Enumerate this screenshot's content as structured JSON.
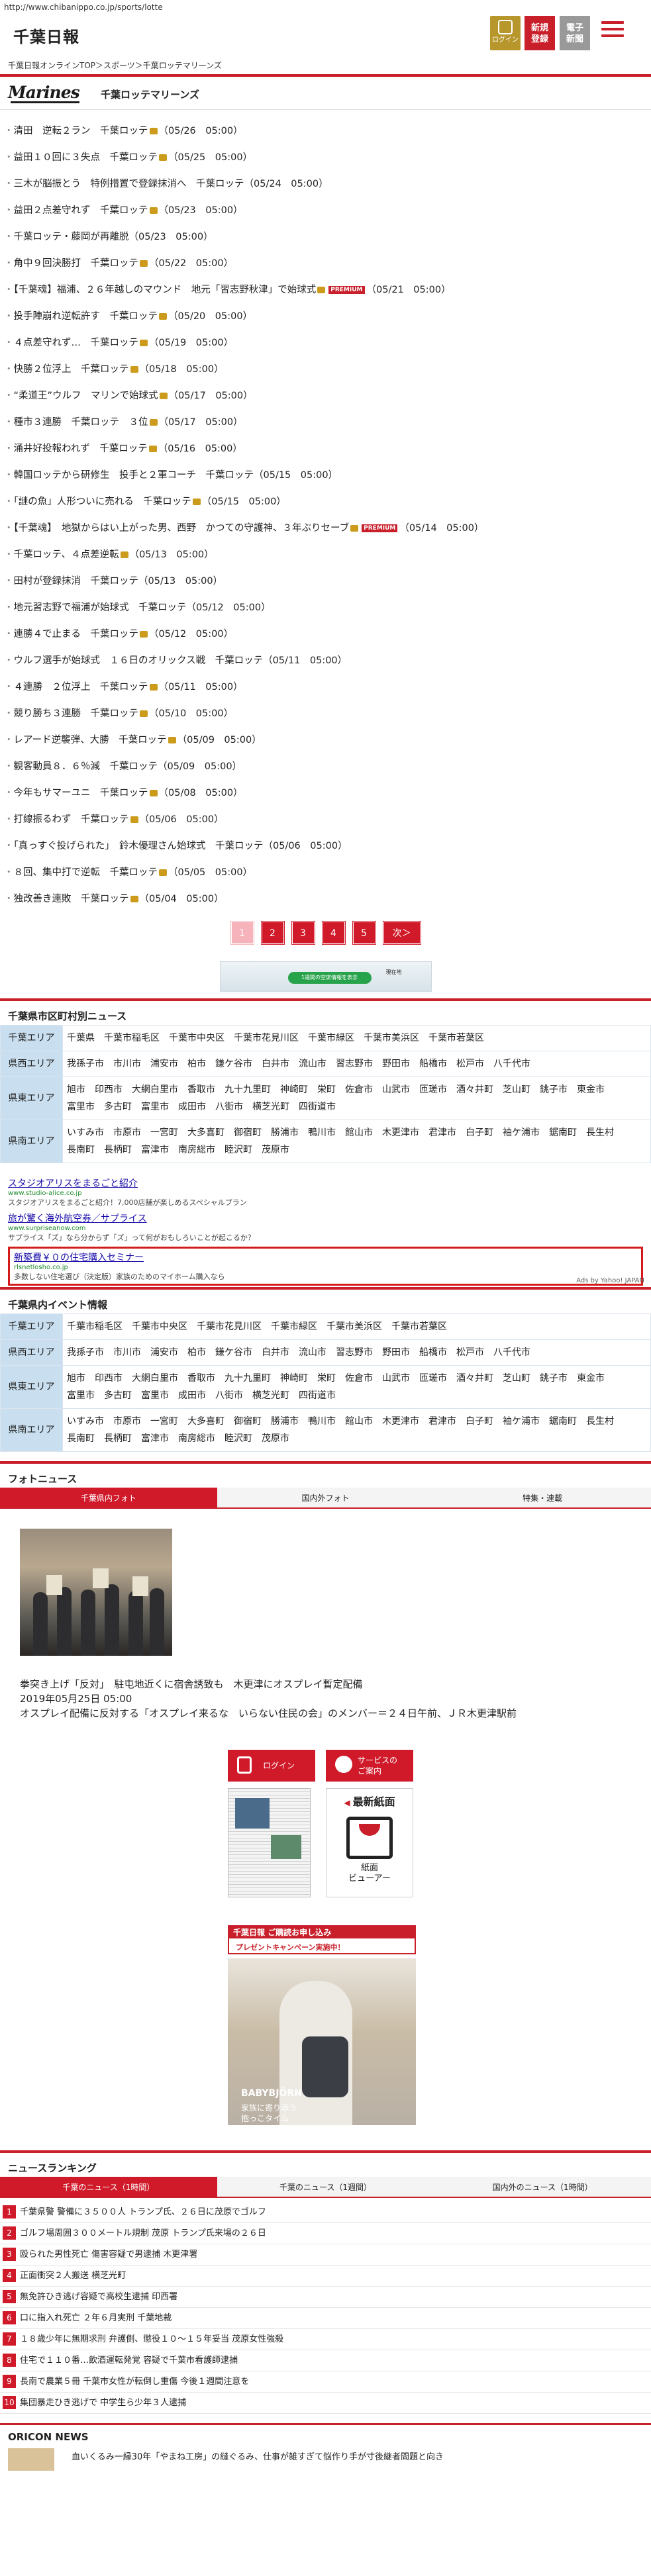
{
  "browser": {
    "url": "http://www.chibanippo.co.jp/sports/lotte"
  },
  "header": {
    "logo": "千葉日報",
    "login": "ログイン",
    "register_1": "新規",
    "register_2": "登録",
    "paper_1": "電子",
    "paper_2": "新聞"
  },
  "breadcrumb": "千葉日報オンラインTOP＞スポーツ＞千葉ロッテマリーンズ",
  "team": {
    "logo_text": "Marines",
    "title": "千葉ロッテマリーンズ"
  },
  "news": [
    {
      "title": "清田　逆転２ラン　千葉ロッテ",
      "date": "（05/26　05:00）",
      "cam": true
    },
    {
      "title": "益田１０回に３失点　千葉ロッテ",
      "date": "（05/25　05:00）",
      "cam": true
    },
    {
      "title": "三木が脳振とう　特例措置で登録抹消へ　千葉ロッテ",
      "date": "（05/24　05:00）",
      "cam": false
    },
    {
      "title": "益田２点差守れず　千葉ロッテ",
      "date": "（05/23　05:00）",
      "cam": true
    },
    {
      "title": "千葉ロッテ・藤岡が再離脱",
      "date": "（05/23　05:00）",
      "cam": false
    },
    {
      "title": "角中９回決勝打　千葉ロッテ",
      "date": "（05/22　05:00）",
      "cam": true
    },
    {
      "title": "【千葉魂】福浦、２６年越しのマウンド　地元「習志野秋津」で始球式",
      "date": "（05/21　05:00）",
      "cam": true,
      "premium": true
    },
    {
      "title": "投手陣崩れ逆転許す　千葉ロッテ",
      "date": "（05/20　05:00）",
      "cam": true
    },
    {
      "title": "４点差守れず…　千葉ロッテ",
      "date": "（05/19　05:00）",
      "cam": true
    },
    {
      "title": "快勝２位浮上　千葉ロッテ",
      "date": "（05/18　05:00）",
      "cam": true
    },
    {
      "title": "“柔道王”ウルフ　マリンで始球式",
      "date": "（05/17　05:00）",
      "cam": true
    },
    {
      "title": "種市３連勝　千葉ロッテ　３位",
      "date": "（05/17　05:00）",
      "cam": true
    },
    {
      "title": "涌井好投報われず　千葉ロッテ",
      "date": "（05/16　05:00）",
      "cam": true
    },
    {
      "title": "韓国ロッテから研修生　投手と２軍コーチ　千葉ロッテ",
      "date": "（05/15　05:00）",
      "cam": false
    },
    {
      "title": "「謎の魚」人形ついに売れる　千葉ロッテ",
      "date": "（05/15　05:00）",
      "cam": true
    },
    {
      "title": "【千葉魂】　地獄からはい上がった男、西野　かつての守護神、３年ぶりセーブ",
      "date": "（05/14　05:00）",
      "cam": true,
      "premium": true
    },
    {
      "title": "千葉ロッテ、４点差逆転",
      "date": "（05/13　05:00）",
      "cam": true
    },
    {
      "title": "田村が登録抹消　千葉ロッテ",
      "date": "（05/13　05:00）",
      "cam": false
    },
    {
      "title": "地元習志野で福浦が始球式　千葉ロッテ",
      "date": "（05/12　05:00）",
      "cam": false
    },
    {
      "title": "連勝４で止まる　千葉ロッテ",
      "date": "（05/12　05:00）",
      "cam": true
    },
    {
      "title": "ウルフ選手が始球式　１６日のオリックス戦　千葉ロッテ",
      "date": "（05/11　05:00）",
      "cam": false
    },
    {
      "title": "４連勝　２位浮上　千葉ロッテ",
      "date": "（05/11　05:00）",
      "cam": true
    },
    {
      "title": "競り勝ち３連勝　千葉ロッテ",
      "date": "（05/10　05:00）",
      "cam": true
    },
    {
      "title": "レアード逆襲弾、大勝　千葉ロッテ",
      "date": "（05/09　05:00）",
      "cam": true
    },
    {
      "title": "観客動員８．６％減　千葉ロッテ",
      "date": "（05/09　05:00）",
      "cam": false
    },
    {
      "title": "今年もサマーユニ　千葉ロッテ",
      "date": "（05/08　05:00）",
      "cam": true
    },
    {
      "title": "打線振るわず　千葉ロッテ",
      "date": "（05/06　05:00）",
      "cam": true
    },
    {
      "title": "「真っすぐ投げられた」　鈴木優理さん始球式　千葉ロッテ",
      "date": "（05/06　05:00）",
      "cam": false
    },
    {
      "title": "８回、集中打で逆転　千葉ロッテ",
      "date": "（05/05　05:00）",
      "cam": true
    },
    {
      "title": "独改善き連敗　千葉ロッテ",
      "date": "（05/04　05:00）",
      "cam": true
    }
  ],
  "premium_badge": "PREMIUM",
  "pager": [
    "1",
    "2",
    "3",
    "4",
    "5",
    "次＞"
  ],
  "map_ad": {
    "pill": "1週間の空席情報を表示",
    "text_right": "現在地"
  },
  "city_news": {
    "heading": "千葉県市区町村別ニュース",
    "rows": [
      {
        "label": "千葉エリア",
        "items": [
          "千葉県",
          "千葉市稲毛区",
          "千葉市中央区",
          "千葉市花見川区",
          "千葉市緑区",
          "千葉市美浜区",
          "千葉市若葉区"
        ]
      },
      {
        "label": "県西エリア",
        "items": [
          "我孫子市",
          "市川市",
          "浦安市",
          "柏市",
          "鎌ケ谷市",
          "白井市",
          "流山市",
          "習志野市",
          "野田市",
          "船橋市",
          "松戸市",
          "八千代市"
        ]
      },
      {
        "label": "県東エリア",
        "items": [
          "旭市",
          "印西市",
          "大網白里市",
          "香取市",
          "九十九里町",
          "神崎町",
          "栄町",
          "佐倉市",
          "山武市",
          "匝瑳市",
          "酒々井町",
          "芝山町",
          "銚子市",
          "東金市",
          "富里市",
          "多古町",
          "富里市",
          "成田市",
          "八街市",
          "横芝光町",
          "四街道市"
        ]
      },
      {
        "label": "県南エリア",
        "items": [
          "いすみ市",
          "市原市",
          "一宮町",
          "大多喜町",
          "御宿町",
          "勝浦市",
          "鴨川市",
          "館山市",
          "木更津市",
          "君津市",
          "白子町",
          "袖ケ浦市",
          "鋸南町",
          "長生村",
          "長南町",
          "長柄町",
          "富津市",
          "南房総市",
          "睦沢町",
          "茂原市"
        ]
      }
    ]
  },
  "text_ads": [
    {
      "title": "スタジオアリスをまるごと紹介",
      "url": "www.studio-alice.co.jp",
      "desc": "スタジオアリスをまるごと紹介！7,000店舗が楽しめるスペシャルプラン",
      "boxed": false
    },
    {
      "title": "旅が驚く海外航空券／サプライス",
      "url": "www.surpriseanow.com",
      "desc": "サプライス「ズ」なら分からず「ズ」って何がおもしろいことが起こるか？",
      "boxed": false
    },
    {
      "title": "新築費￥０の住宅購入セミナー",
      "url": "rlsnetlosho.co.jp",
      "desc": "多数しない住宅選び（決定版）家族のためのマイホーム購入なら",
      "boxed": true
    }
  ],
  "ads_by": "Ads by Yahoo! JAPAN",
  "events": {
    "heading": "千葉県内イベント情報",
    "rows": [
      {
        "label": "千葉エリア",
        "items": [
          "千葉市稲毛区",
          "千葉市中央区",
          "千葉市花見川区",
          "千葉市緑区",
          "千葉市美浜区",
          "千葉市若葉区"
        ]
      },
      {
        "label": "県西エリア",
        "items": [
          "我孫子市",
          "市川市",
          "浦安市",
          "柏市",
          "鎌ケ谷市",
          "白井市",
          "流山市",
          "習志野市",
          "野田市",
          "船橋市",
          "松戸市",
          "八千代市"
        ]
      },
      {
        "label": "県東エリア",
        "items": [
          "旭市",
          "印西市",
          "大網白里市",
          "香取市",
          "九十九里町",
          "神崎町",
          "栄町",
          "佐倉市",
          "山武市",
          "匝瑳市",
          "酒々井町",
          "芝山町",
          "銚子市",
          "東金市",
          "富里市",
          "多古町",
          "富里市",
          "成田市",
          "八街市",
          "横芝光町",
          "四街道市"
        ]
      },
      {
        "label": "県南エリア",
        "items": [
          "いすみ市",
          "市原市",
          "一宮町",
          "大多喜町",
          "御宿町",
          "勝浦市",
          "鴨川市",
          "館山市",
          "木更津市",
          "君津市",
          "白子町",
          "袖ケ浦市",
          "鋸南町",
          "長生村",
          "長南町",
          "長柄町",
          "富津市",
          "南房総市",
          "睦沢町",
          "茂原市"
        ]
      }
    ]
  },
  "photo_news": {
    "heading": "フォトニュース",
    "tabs": [
      "千葉県内フォト",
      "国内外フォト",
      "特集・連載"
    ],
    "caption": "拳突き上げ「反対」　駐屯地近くに宿舎誘致も　木更津にオスプレイ暫定配備",
    "date": "2019年05月25日 05:00",
    "desc": "オスプレイ配備に反対する「オスプレイ来るな　いらない住民の会」のメンバー＝２４日午前、ＪＲ木更津駅前"
  },
  "side": {
    "login": "ログイン",
    "service_1": "サービスの",
    "service_2": "ご案内",
    "latest": "最新紙面",
    "viewer_1": "紙面",
    "viewer_2": "ビューアー",
    "campaign_top": "千葉日報 ご購読お申し込み",
    "campaign_bottom": "プレゼントキャンペーン実施中！"
  },
  "baby_ad": {
    "brand": "BABYBJÖRN",
    "copy_1": "家族に寄り添う",
    "copy_2": "抱っこタイム"
  },
  "ranking": {
    "heading": "ニュースランキング",
    "tabs": [
      "千葉のニュース（1時間）",
      "千葉のニュース（1週間）",
      "国内外のニュース（1時間）"
    ],
    "items": [
      "千葉県警 警備に３５００人 トランプ氏、２６日に茂原でゴルフ",
      "ゴルフ場周囲３００メートル規制 茂原 トランプ氏来場の２６日",
      "殴られた男性死亡 傷害容疑で男逮捕 木更津署",
      "正面衝突２人搬送 横芝光町",
      "無免許ひき逃げ容疑で高校生逮捕 印西署",
      "口に指入れ死亡 ２年６月実刑 千葉地裁",
      "１８歳少年に無期求刑 弁護側、懲役１０～１５年妥当 茂原女性強殺",
      "住宅で１１０番…飲酒運転発覚 容疑で千葉市看護師逮捕",
      "長南で農業５冊 千葉市女性が転倒し重傷 今後１週間注意を",
      "集団暴走ひき逃げで 中学生ら少年３人逮捕"
    ]
  },
  "oricon": {
    "heading": "ORICON NEWS",
    "item": "血いくるみ一縁30年「やまね工房」の縫ぐるみ、仕事が雑すぎて悩作り手が寸後継者問題と向き"
  }
}
